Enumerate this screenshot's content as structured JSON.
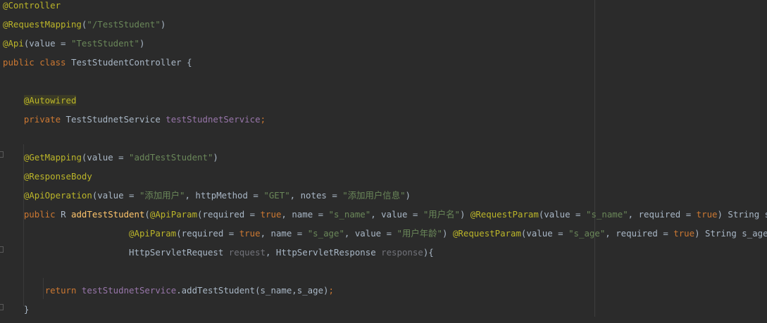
{
  "editor": {
    "lines": [
      [
        {
          "t": "@Controller",
          "c": "annotation"
        }
      ],
      [
        {
          "t": "@RequestMapping",
          "c": "annotation"
        },
        {
          "t": "(",
          "c": "plain"
        },
        {
          "t": "\"/TestStudent\"",
          "c": "str"
        },
        {
          "t": ")",
          "c": "plain"
        }
      ],
      [
        {
          "t": "@Api",
          "c": "annotation"
        },
        {
          "t": "(value = ",
          "c": "plain"
        },
        {
          "t": "\"TestStudent\"",
          "c": "str"
        },
        {
          "t": ")",
          "c": "plain"
        }
      ],
      [
        {
          "t": "public class ",
          "c": "kw"
        },
        {
          "t": "TestStudentController {",
          "c": "plain"
        }
      ],
      [],
      [
        {
          "t": "    ",
          "c": "plain"
        },
        {
          "t": "@Autowired",
          "c": "annotation hl"
        }
      ],
      [
        {
          "t": "    ",
          "c": "plain"
        },
        {
          "t": "private ",
          "c": "kw"
        },
        {
          "t": "TestStudnetService ",
          "c": "plain"
        },
        {
          "t": "testStudnetService",
          "c": "fld"
        },
        {
          "t": ";",
          "c": "kw"
        }
      ],
      [],
      [
        {
          "t": "    ",
          "c": "plain"
        },
        {
          "t": "@GetMapping",
          "c": "annotation"
        },
        {
          "t": "(value = ",
          "c": "plain"
        },
        {
          "t": "\"addTestStudent\"",
          "c": "str"
        },
        {
          "t": ")",
          "c": "plain"
        }
      ],
      [
        {
          "t": "    ",
          "c": "plain"
        },
        {
          "t": "@ResponseBody",
          "c": "annotation"
        }
      ],
      [
        {
          "t": "    ",
          "c": "plain"
        },
        {
          "t": "@ApiOperation",
          "c": "annotation"
        },
        {
          "t": "(value = ",
          "c": "plain"
        },
        {
          "t": "\"添加用户\"",
          "c": "str"
        },
        {
          "t": ", httpMethod = ",
          "c": "plain"
        },
        {
          "t": "\"GET\"",
          "c": "str"
        },
        {
          "t": ", notes = ",
          "c": "plain"
        },
        {
          "t": "\"添加用户信息\"",
          "c": "str"
        },
        {
          "t": ")",
          "c": "plain"
        }
      ],
      [
        {
          "t": "    ",
          "c": "plain"
        },
        {
          "t": "public ",
          "c": "kw"
        },
        {
          "t": "R ",
          "c": "plain"
        },
        {
          "t": "addTestStudent",
          "c": "mth"
        },
        {
          "t": "(",
          "c": "plain"
        },
        {
          "t": "@ApiParam",
          "c": "annotation"
        },
        {
          "t": "(required = ",
          "c": "plain"
        },
        {
          "t": "true",
          "c": "kw"
        },
        {
          "t": ", name = ",
          "c": "plain"
        },
        {
          "t": "\"s_name\"",
          "c": "str"
        },
        {
          "t": ", value = ",
          "c": "plain"
        },
        {
          "t": "\"用户名\"",
          "c": "str"
        },
        {
          "t": ") ",
          "c": "plain"
        },
        {
          "t": "@RequestParam",
          "c": "annotation"
        },
        {
          "t": "(value = ",
          "c": "plain"
        },
        {
          "t": "\"s_name\"",
          "c": "str"
        },
        {
          "t": ", required = ",
          "c": "plain"
        },
        {
          "t": "true",
          "c": "kw"
        },
        {
          "t": ") String s_name,",
          "c": "plain"
        }
      ],
      [
        {
          "t": "                        ",
          "c": "plain"
        },
        {
          "t": "@ApiParam",
          "c": "annotation"
        },
        {
          "t": "(required = ",
          "c": "plain"
        },
        {
          "t": "true",
          "c": "kw"
        },
        {
          "t": ", name = ",
          "c": "plain"
        },
        {
          "t": "\"s_age\"",
          "c": "str"
        },
        {
          "t": ", value = ",
          "c": "plain"
        },
        {
          "t": "\"用户年龄\"",
          "c": "str"
        },
        {
          "t": ") ",
          "c": "plain"
        },
        {
          "t": "@RequestParam",
          "c": "annotation"
        },
        {
          "t": "(value = ",
          "c": "plain"
        },
        {
          "t": "\"s_age\"",
          "c": "str"
        },
        {
          "t": ", required = ",
          "c": "plain"
        },
        {
          "t": "true",
          "c": "kw"
        },
        {
          "t": ") String s_age,",
          "c": "plain"
        }
      ],
      [
        {
          "t": "                        ",
          "c": "plain"
        },
        {
          "t": "HttpServletRequest ",
          "c": "plain"
        },
        {
          "t": "request",
          "c": "prm"
        },
        {
          "t": ", HttpServletResponse ",
          "c": "plain"
        },
        {
          "t": "response",
          "c": "prm"
        },
        {
          "t": "){",
          "c": "plain"
        }
      ],
      [],
      [
        {
          "t": "        ",
          "c": "plain"
        },
        {
          "t": "return ",
          "c": "kw"
        },
        {
          "t": "testStudnetService",
          "c": "fld"
        },
        {
          "t": ".addTestStudent(s_name,s_age)",
          "c": "plain"
        },
        {
          "t": ";",
          "c": "kw"
        }
      ],
      [
        {
          "t": "    }",
          "c": "plain"
        }
      ]
    ]
  },
  "colors": {
    "background": "#2b2b2b",
    "annotation": "#bbb529",
    "keyword": "#cc7832",
    "string": "#6a8759",
    "field": "#9876aa",
    "text": "#a9b7c6"
  }
}
